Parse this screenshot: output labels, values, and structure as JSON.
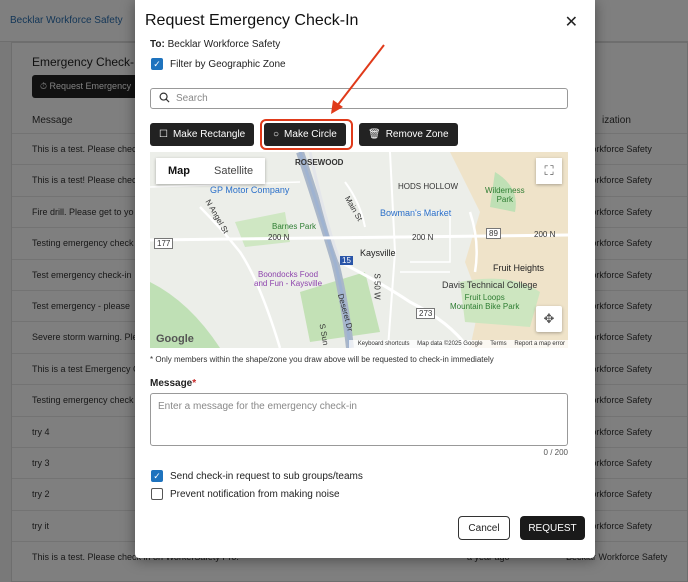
{
  "background": {
    "breadcrumb": "Becklar Workforce Safety",
    "title": "Emergency Check-In",
    "request_button": "Request Emergency",
    "columns": {
      "message": "Message",
      "organization": "ization"
    },
    "rows": [
      {
        "message": "This is a test. Please chec",
        "time": "",
        "org": "klar Workforce Safety"
      },
      {
        "message": "This is a test! Please chec",
        "time": "",
        "org": "klar Workforce Safety"
      },
      {
        "message": "Fire drill. Please get to yo",
        "time": "",
        "org": "klar Workforce Safety"
      },
      {
        "message": "Testing emergency check",
        "time": "",
        "org": "klar Workforce Safety"
      },
      {
        "message": "Test emergency check-in",
        "time": "",
        "org": "klar Workforce Safety"
      },
      {
        "message": "Test emergency - please",
        "time": "",
        "org": "klar Workforce Safety"
      },
      {
        "message": "Severe storm warning. Ple",
        "time": "",
        "org": "klar Workforce Safety"
      },
      {
        "message": "This is a test Emergency C",
        "time": "",
        "org": "klar Workforce Safety"
      },
      {
        "message": "Testing emergency check",
        "time": "",
        "org": "klar Workforce Safety"
      },
      {
        "message": "try 4",
        "time": "",
        "org": "klar Workforce Safety"
      },
      {
        "message": "try 3",
        "time": "",
        "org": "klar Workforce Safety"
      },
      {
        "message": "try 2",
        "time": "",
        "org": "klar Workforce Safety"
      },
      {
        "message": "try it",
        "time": "",
        "org": "klar Workforce Safety"
      },
      {
        "message": "This is a test. Please check in on WorkerSafety Pro.",
        "time": "a year ago",
        "org": "Becklar Workforce Safety"
      }
    ]
  },
  "modal": {
    "title": "Request Emergency Check-In",
    "to_label": "To:",
    "to_value": "Becklar Workforce Safety",
    "filter_label": "Filter by Geographic Zone",
    "search_placeholder": "Search",
    "make_rectangle": "Make Rectangle",
    "make_circle": "Make Circle",
    "remove_zone": "Remove Zone",
    "map": {
      "tab_map": "Map",
      "tab_satellite": "Satellite",
      "labels": {
        "rosewood": "ROSEWOOD",
        "gp_motor": "GP Motor Company",
        "hods_hollow": "HODS HOLLOW",
        "wilderness_park": "Wilderness\nPark",
        "bowmans": "Bowman's Market",
        "main_st": "Main St",
        "angel_st": "N Angel St",
        "barnes_park": "Barnes Park",
        "n200_a": "200 N",
        "n200_b": "200 N",
        "n200_c": "200 N",
        "kaysville": "Kaysville",
        "fruit_heights": "Fruit Heights",
        "boondocks": "Boondocks Food\nand Fun - Kaysville",
        "davis_tech": "Davis Technical College",
        "fruit_loops": "Fruit Loops\nMountain Bike Park",
        "s50w": "S 50 W",
        "deseret": "Deseret Dr",
        "r177": "177",
        "r15": "15",
        "r89": "89",
        "r273": "273",
        "sunset": "S Sun"
      },
      "google": "Google",
      "attribution": {
        "shortcuts": "Keyboard shortcuts",
        "data": "Map data ©2025 Google",
        "terms": "Terms",
        "report": "Report a map error"
      }
    },
    "note": "* Only members within the shape/zone you draw above will be requested to check-in immediately",
    "message_label": "Message",
    "message_required": "*",
    "message_placeholder": "Enter a message for the emergency check-in",
    "counter": "0 / 200",
    "subgroups_label": "Send check-in request to sub groups/teams",
    "noise_label": "Prevent notification from making noise",
    "cancel": "Cancel",
    "request": "REQUEST"
  },
  "colors": {
    "accent": "#1e73be",
    "highlight": "#e03a1a",
    "dark_button": "#222222"
  }
}
